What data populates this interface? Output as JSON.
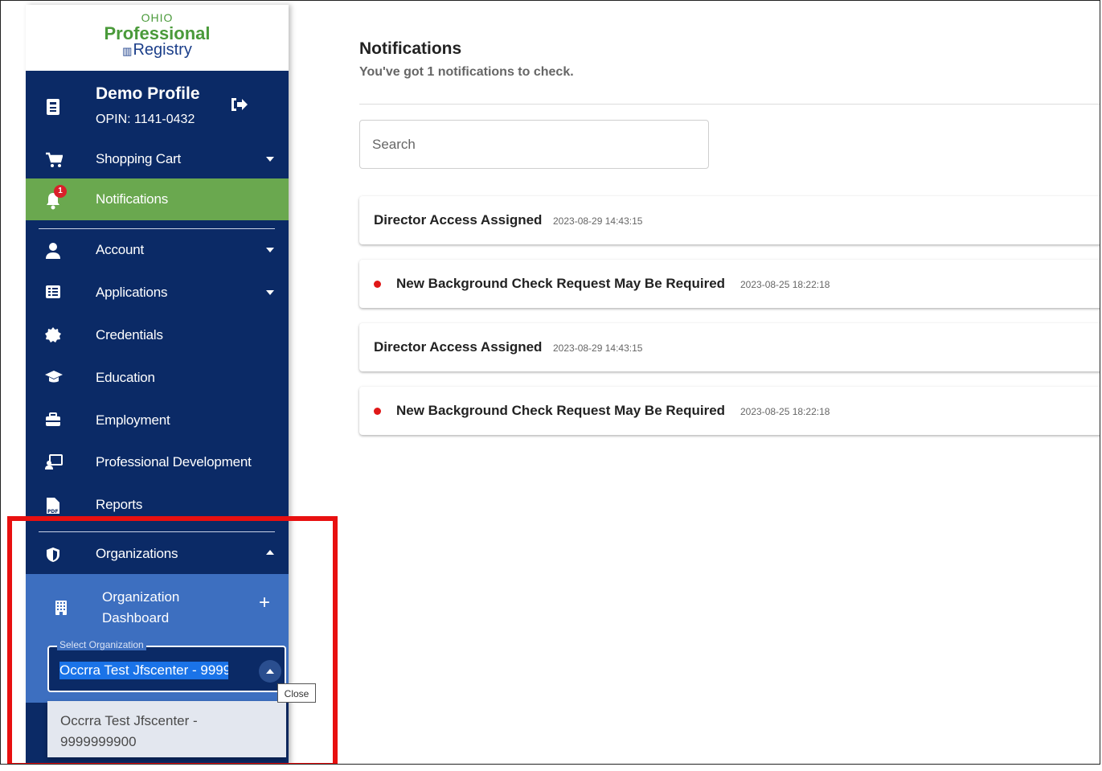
{
  "logo": {
    "line1": "OHIO",
    "line2": "Professional",
    "line3": "Registry"
  },
  "profile": {
    "name": "Demo Profile",
    "opin": "OPIN: 1141-0432"
  },
  "nav": {
    "shopping_cart": "Shopping Cart",
    "notifications": "Notifications",
    "notifications_badge": "1",
    "account": "Account",
    "applications": "Applications",
    "credentials": "Credentials",
    "education": "Education",
    "employment": "Employment",
    "professional_development": "Professional Development",
    "reports": "Reports",
    "organizations": "Organizations",
    "organization_dashboard": "Organization Dashboard"
  },
  "org_select": {
    "legend": "Select Organization",
    "value": "Occrra Test Jfscenter - 9999999900",
    "options": [
      "Occrra Test Jfscenter - 9999999900"
    ],
    "tooltip": "Close"
  },
  "main": {
    "title": "Notifications",
    "subtitle": "You've got 1 notifications to check.",
    "search_placeholder": "Search",
    "notifications": [
      {
        "title": "Director Access Assigned",
        "timestamp": "2023-08-29 14:43:15",
        "unread": false
      },
      {
        "title": "New Background Check Request May Be Required",
        "timestamp": "2023-08-25 18:22:18",
        "unread": true
      },
      {
        "title": "Director Access Assigned",
        "timestamp": "2023-08-29 14:43:15",
        "unread": false
      },
      {
        "title": "New Background Check Request May Be Required",
        "timestamp": "2023-08-25 18:22:18",
        "unread": true
      }
    ]
  },
  "colors": {
    "sidebar_bg": "#0b2a66",
    "active_nav": "#6aa84f",
    "org_dashboard_bg": "#3d6fc0",
    "unread_dot": "#e01818",
    "highlight_box": "#e81010"
  }
}
